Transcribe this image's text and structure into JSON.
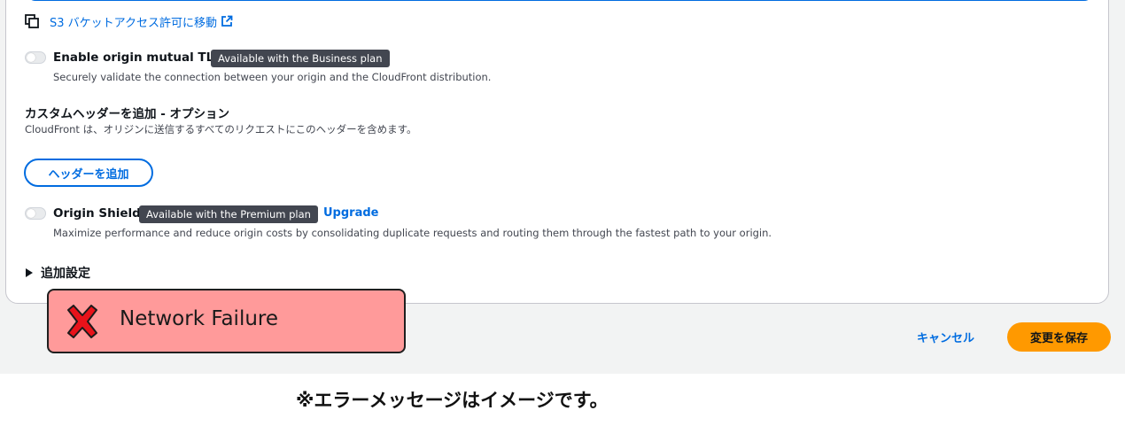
{
  "s3_link": {
    "label": "S3 バケットアクセス許可に移動",
    "icon": "external-link-icon"
  },
  "mtls": {
    "title": "Enable origin mutual TLS",
    "badge": "Available with the Business plan",
    "description": "Securely validate the connection between your origin and the CloudFront distribution.",
    "enabled": false
  },
  "custom_headers": {
    "heading": "カスタムヘッダーを追加 - オプション",
    "description": "CloudFront は、オリジンに送信するすべてのリクエストにこのヘッダーを含めます。",
    "add_button": "ヘッダーを追加"
  },
  "origin_shield": {
    "title": "Origin Shield",
    "badge": "Available with the Premium plan",
    "upgrade": "Upgrade",
    "description": "Maximize performance and reduce origin costs by consolidating duplicate requests and routing them through the fastest path to your origin.",
    "enabled": false
  },
  "additional_settings": {
    "label": "追加設定"
  },
  "footer": {
    "cancel": "キャンセル",
    "save": "変更を保存"
  },
  "error": {
    "message": "Network Failure",
    "icon": "x-icon",
    "background": "#ff9a9a"
  },
  "note": "※エラーメッセージはイメージです。",
  "colors": {
    "link": "#006ce0",
    "primary_button": "#ff9900",
    "badge_bg": "#424650"
  }
}
